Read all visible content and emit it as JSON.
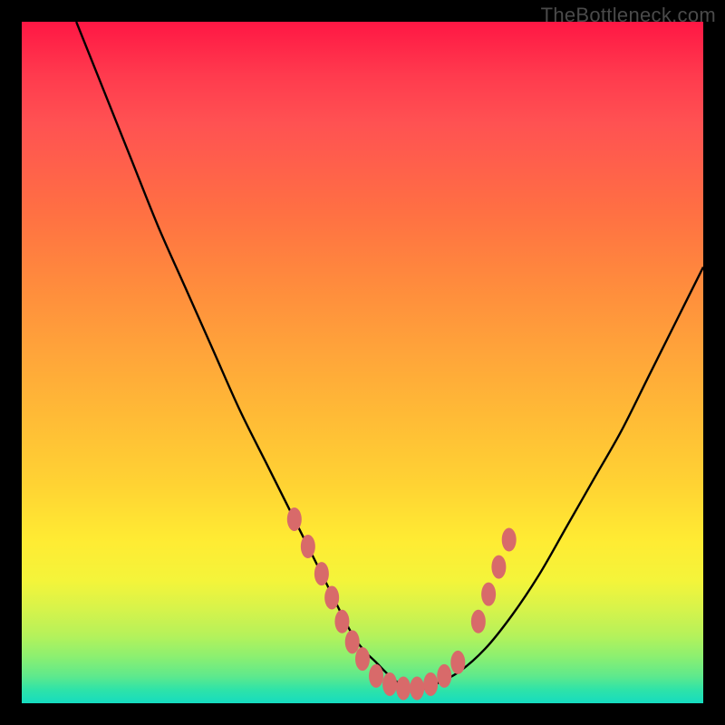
{
  "watermark": "TheBottleneck.com",
  "colors": {
    "curve": "#000000",
    "marker_fill": "#d86a6a",
    "marker_stroke": "#c95a5a"
  },
  "chart_data": {
    "type": "line",
    "title": "",
    "xlabel": "",
    "ylabel": "",
    "xlim": [
      0,
      100
    ],
    "ylim": [
      0,
      100
    ],
    "grid": false,
    "series": [
      {
        "name": "bottleneck-curve",
        "x": [
          8,
          12,
          16,
          20,
          24,
          28,
          32,
          36,
          40,
          44,
          48,
          50,
          52,
          54,
          56,
          58,
          60,
          64,
          68,
          72,
          76,
          80,
          84,
          88,
          92,
          96,
          100
        ],
        "y": [
          100,
          90,
          80,
          70,
          61,
          52,
          43,
          35,
          27,
          19,
          11,
          8,
          6,
          4,
          2.5,
          2,
          2.5,
          4.5,
          8,
          13,
          19,
          26,
          33,
          40,
          48,
          56,
          64
        ]
      }
    ],
    "markers": [
      {
        "x": 40,
        "y": 27
      },
      {
        "x": 42,
        "y": 23
      },
      {
        "x": 44,
        "y": 19
      },
      {
        "x": 45.5,
        "y": 15.5
      },
      {
        "x": 47,
        "y": 12
      },
      {
        "x": 48.5,
        "y": 9
      },
      {
        "x": 50,
        "y": 6.5
      },
      {
        "x": 52,
        "y": 4
      },
      {
        "x": 54,
        "y": 2.8
      },
      {
        "x": 56,
        "y": 2.2
      },
      {
        "x": 58,
        "y": 2.2
      },
      {
        "x": 60,
        "y": 2.8
      },
      {
        "x": 62,
        "y": 4
      },
      {
        "x": 64,
        "y": 6
      },
      {
        "x": 67,
        "y": 12
      },
      {
        "x": 68.5,
        "y": 16
      },
      {
        "x": 70,
        "y": 20
      },
      {
        "x": 71.5,
        "y": 24
      }
    ]
  }
}
